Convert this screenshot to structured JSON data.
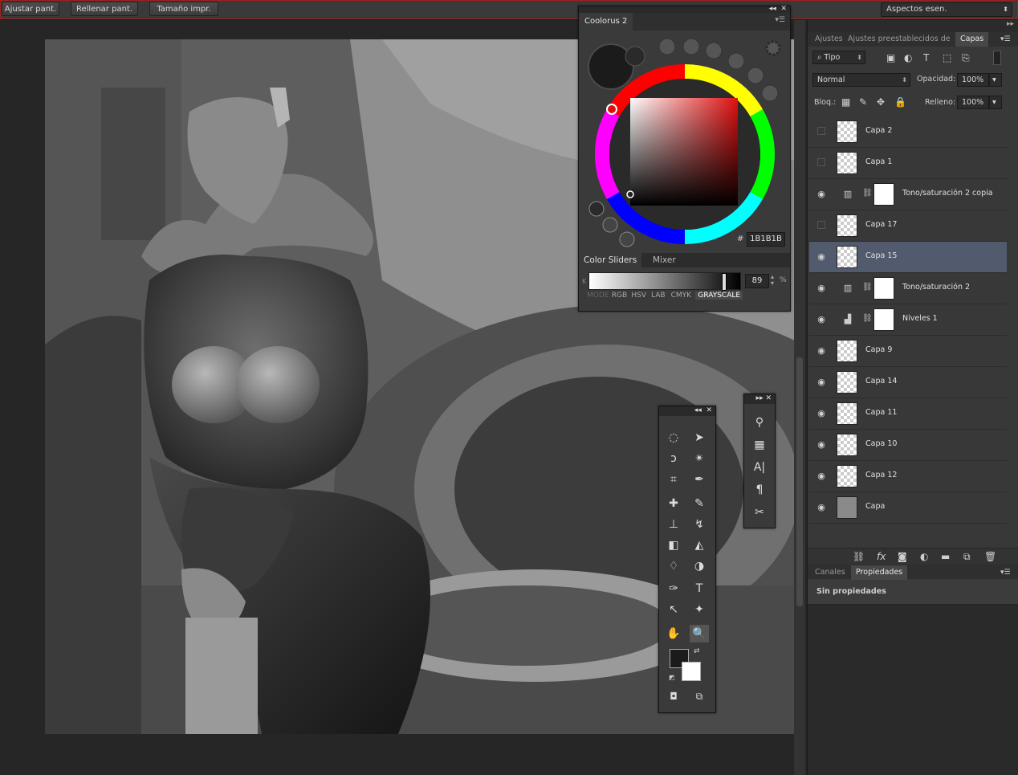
{
  "options_bar": {
    "buttons": [
      "Ajustar pant.",
      "Rellenar pant.",
      "Tamaño impr."
    ],
    "workspace": "Aspectos esen."
  },
  "coolorus": {
    "title": "Coolorus 2",
    "hex_symbol": "#",
    "hex_value": "1B1B1B",
    "tabs": [
      "Color Sliders",
      "Mixer"
    ],
    "slider_channel": "K",
    "slider_value": "89",
    "slider_unit": "%",
    "slider_fraction": 0.89,
    "modes": [
      "MODE",
      "RGB",
      "HSV",
      "LAB",
      "CMYK",
      "GRAYSCALE"
    ],
    "active_mode": "GRAYSCALE",
    "current_color": "#1b1b1b",
    "hue_color": "#e01010"
  },
  "dock": {
    "tabs": [
      "Ajustes",
      "Ajustes preestablecidos de p",
      "Capas"
    ],
    "active_tab": "Capas",
    "filter_kind": "Tipo",
    "blend_mode": "Normal",
    "opacity_label": "Opacidad:",
    "opacity_value": "100%",
    "lock_label": "Bloq.:",
    "fill_label": "Relleno:",
    "fill_value": "100%",
    "bottom_tabs": [
      "Canales",
      "Propiedades"
    ],
    "active_bottom_tab": "Propiedades",
    "properties_text": "Sin propiedades"
  },
  "layers": [
    {
      "name": "Capa 2",
      "visible": false,
      "type": "pixel",
      "selected": false
    },
    {
      "name": "Capa 1",
      "visible": false,
      "type": "pixel",
      "selected": false
    },
    {
      "name": "Tono/saturación 2 copia",
      "visible": true,
      "type": "hue-sat",
      "selected": false
    },
    {
      "name": "Capa 17",
      "visible": false,
      "type": "pixel",
      "selected": false
    },
    {
      "name": "Capa 15",
      "visible": true,
      "type": "pixel",
      "selected": true
    },
    {
      "name": "Tono/saturación 2",
      "visible": true,
      "type": "hue-sat",
      "selected": false
    },
    {
      "name": "Niveles 1",
      "visible": true,
      "type": "levels",
      "selected": false
    },
    {
      "name": "Capa 9",
      "visible": true,
      "type": "pixel",
      "selected": false
    },
    {
      "name": "Capa 14",
      "visible": true,
      "type": "pixel",
      "selected": false
    },
    {
      "name": "Capa 11",
      "visible": true,
      "type": "pixel",
      "selected": false
    },
    {
      "name": "Capa 10",
      "visible": true,
      "type": "pixel",
      "selected": false
    },
    {
      "name": "Capa 12",
      "visible": true,
      "type": "pixel",
      "selected": false
    },
    {
      "name": "Capa",
      "visible": true,
      "type": "fill",
      "selected": false
    }
  ]
}
